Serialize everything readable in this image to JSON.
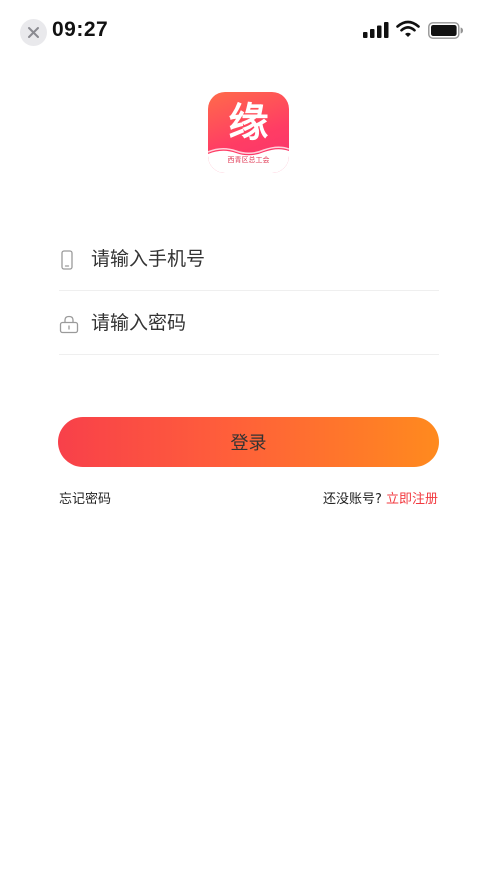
{
  "status_bar": {
    "time": "09:27"
  },
  "logo": {
    "char": "缘",
    "subtitle": "西青区总工会"
  },
  "form": {
    "phone_placeholder": "请输入手机号",
    "password_placeholder": "请输入密码",
    "login_label": "登录"
  },
  "links": {
    "forgot_password": "忘记密码",
    "no_account": "还没账号?",
    "register": "立即注册"
  },
  "colors": {
    "accent_start": "#f8404a",
    "accent_end": "#ff8a1e",
    "link_red": "#f2393f"
  }
}
